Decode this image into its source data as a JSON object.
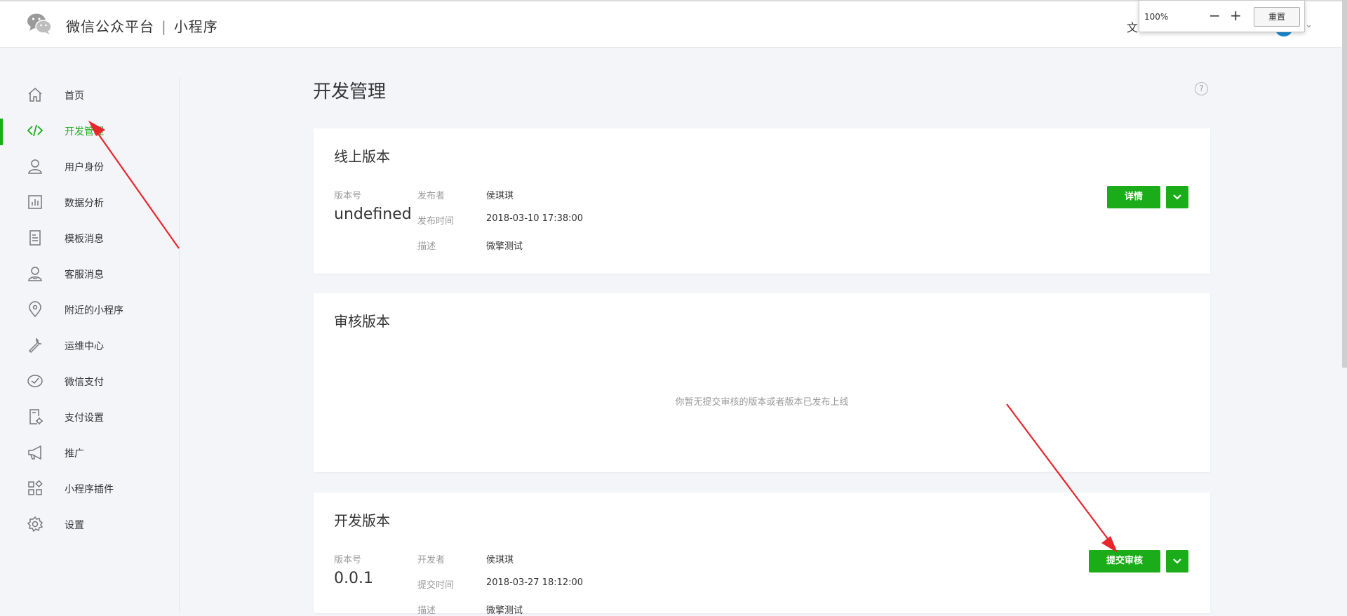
{
  "header": {
    "brand": "微信公众平台",
    "separator": "|",
    "product": "小程序",
    "right_text": "文"
  },
  "zoom": {
    "value": "100%",
    "minus": "−",
    "plus": "+",
    "reset": "重置"
  },
  "sidebar": {
    "items": [
      {
        "label": "首页",
        "icon": "home-icon"
      },
      {
        "label": "开发管理",
        "icon": "code-icon",
        "active": true
      },
      {
        "label": "用户身份",
        "icon": "user-icon"
      },
      {
        "label": "数据分析",
        "icon": "chart-icon"
      },
      {
        "label": "模板消息",
        "icon": "document-icon"
      },
      {
        "label": "客服消息",
        "icon": "support-icon"
      },
      {
        "label": "附近的小程序",
        "icon": "location-icon"
      },
      {
        "label": "运维中心",
        "icon": "wrench-icon"
      },
      {
        "label": "微信支付",
        "icon": "payment-icon"
      },
      {
        "label": "支付设置",
        "icon": "payment-settings-icon"
      },
      {
        "label": "推广",
        "icon": "megaphone-icon"
      },
      {
        "label": "小程序插件",
        "icon": "plugin-icon"
      },
      {
        "label": "设置",
        "icon": "gear-icon"
      }
    ]
  },
  "main": {
    "title": "开发管理",
    "help": "?",
    "online": {
      "title": "线上版本",
      "version_label": "版本号",
      "version_value": "undefined",
      "rows": [
        {
          "key": "发布者",
          "value": "侯琪琪"
        },
        {
          "key": "发布时间",
          "value": "2018-03-10 17:38:00"
        },
        {
          "key": "描述",
          "value": "微擎测试"
        }
      ],
      "button": "详情"
    },
    "review": {
      "title": "审核版本",
      "empty": "你暂无提交审核的版本或者版本已发布上线"
    },
    "dev": {
      "title": "开发版本",
      "version_label": "版本号",
      "version_value": "0.0.1",
      "rows": [
        {
          "key": "开发者",
          "value": "侯琪琪"
        },
        {
          "key": "提交时间",
          "value": "2018-03-27 18:12:00"
        },
        {
          "key": "描述",
          "value": "微擎测试"
        }
      ],
      "button": "提交审核"
    }
  },
  "colors": {
    "accent": "#1aad19",
    "annotation": "#e8262b"
  }
}
